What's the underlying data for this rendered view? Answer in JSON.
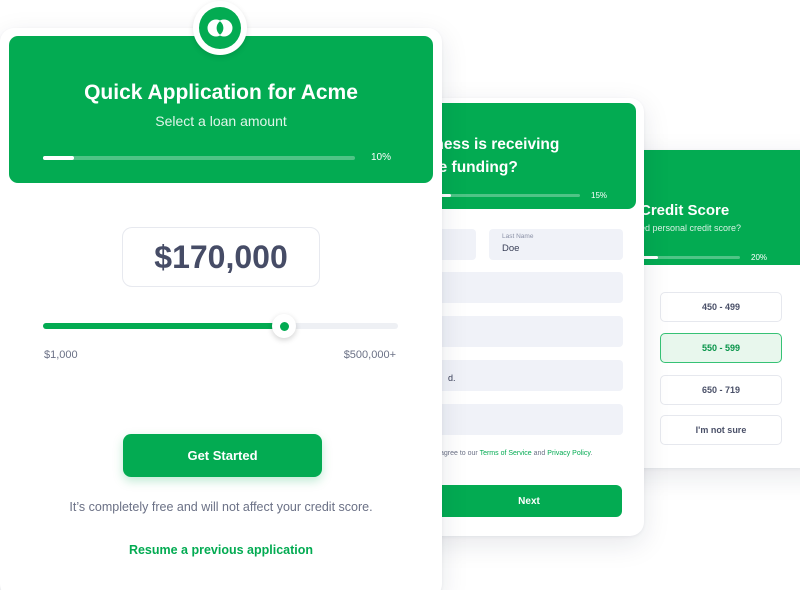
{
  "theme": {
    "accent": "#03ab52",
    "accent_light": "#e8f7ed",
    "text_dark": "#464c66",
    "text_muted": "#6b7186"
  },
  "loan_card": {
    "logo_icon": "overlapping-circles-logo",
    "title": "Quick Application for Acme",
    "subtitle": "Select a loan amount",
    "progress_label": "10%",
    "progress_value": 0.1,
    "amount": "$170,000",
    "slider_min_label": "$1,000",
    "slider_max_label": "$500,000+",
    "slider_value": 0.68,
    "cta_label": "Get Started",
    "free_note": "It’s completely free and will not affect your credit score.",
    "resume_label": "Resume a previous application"
  },
  "business_card": {
    "title_line1": "usiness is receiving",
    "title_line2": "the funding?",
    "progress_label": "15%",
    "progress_value": 0.15,
    "last_name_label": "Last Name",
    "last_name_value": "Doe",
    "partial_field_text": "d.",
    "terms_prefix": "agree to our ",
    "terms_link": "Terms of Service",
    "terms_mid": " and ",
    "privacy_link": "Privacy Policy",
    "terms_suffix": ".",
    "next_label": "Next"
  },
  "credit_card": {
    "title": "Credit Score",
    "subtitle": "ed personal credit score?",
    "progress_label": "20%",
    "progress_value": 0.2,
    "options": [
      "450 - 499",
      "550 - 599",
      "650 - 719",
      "I'm not sure"
    ],
    "selected_index": 1
  }
}
